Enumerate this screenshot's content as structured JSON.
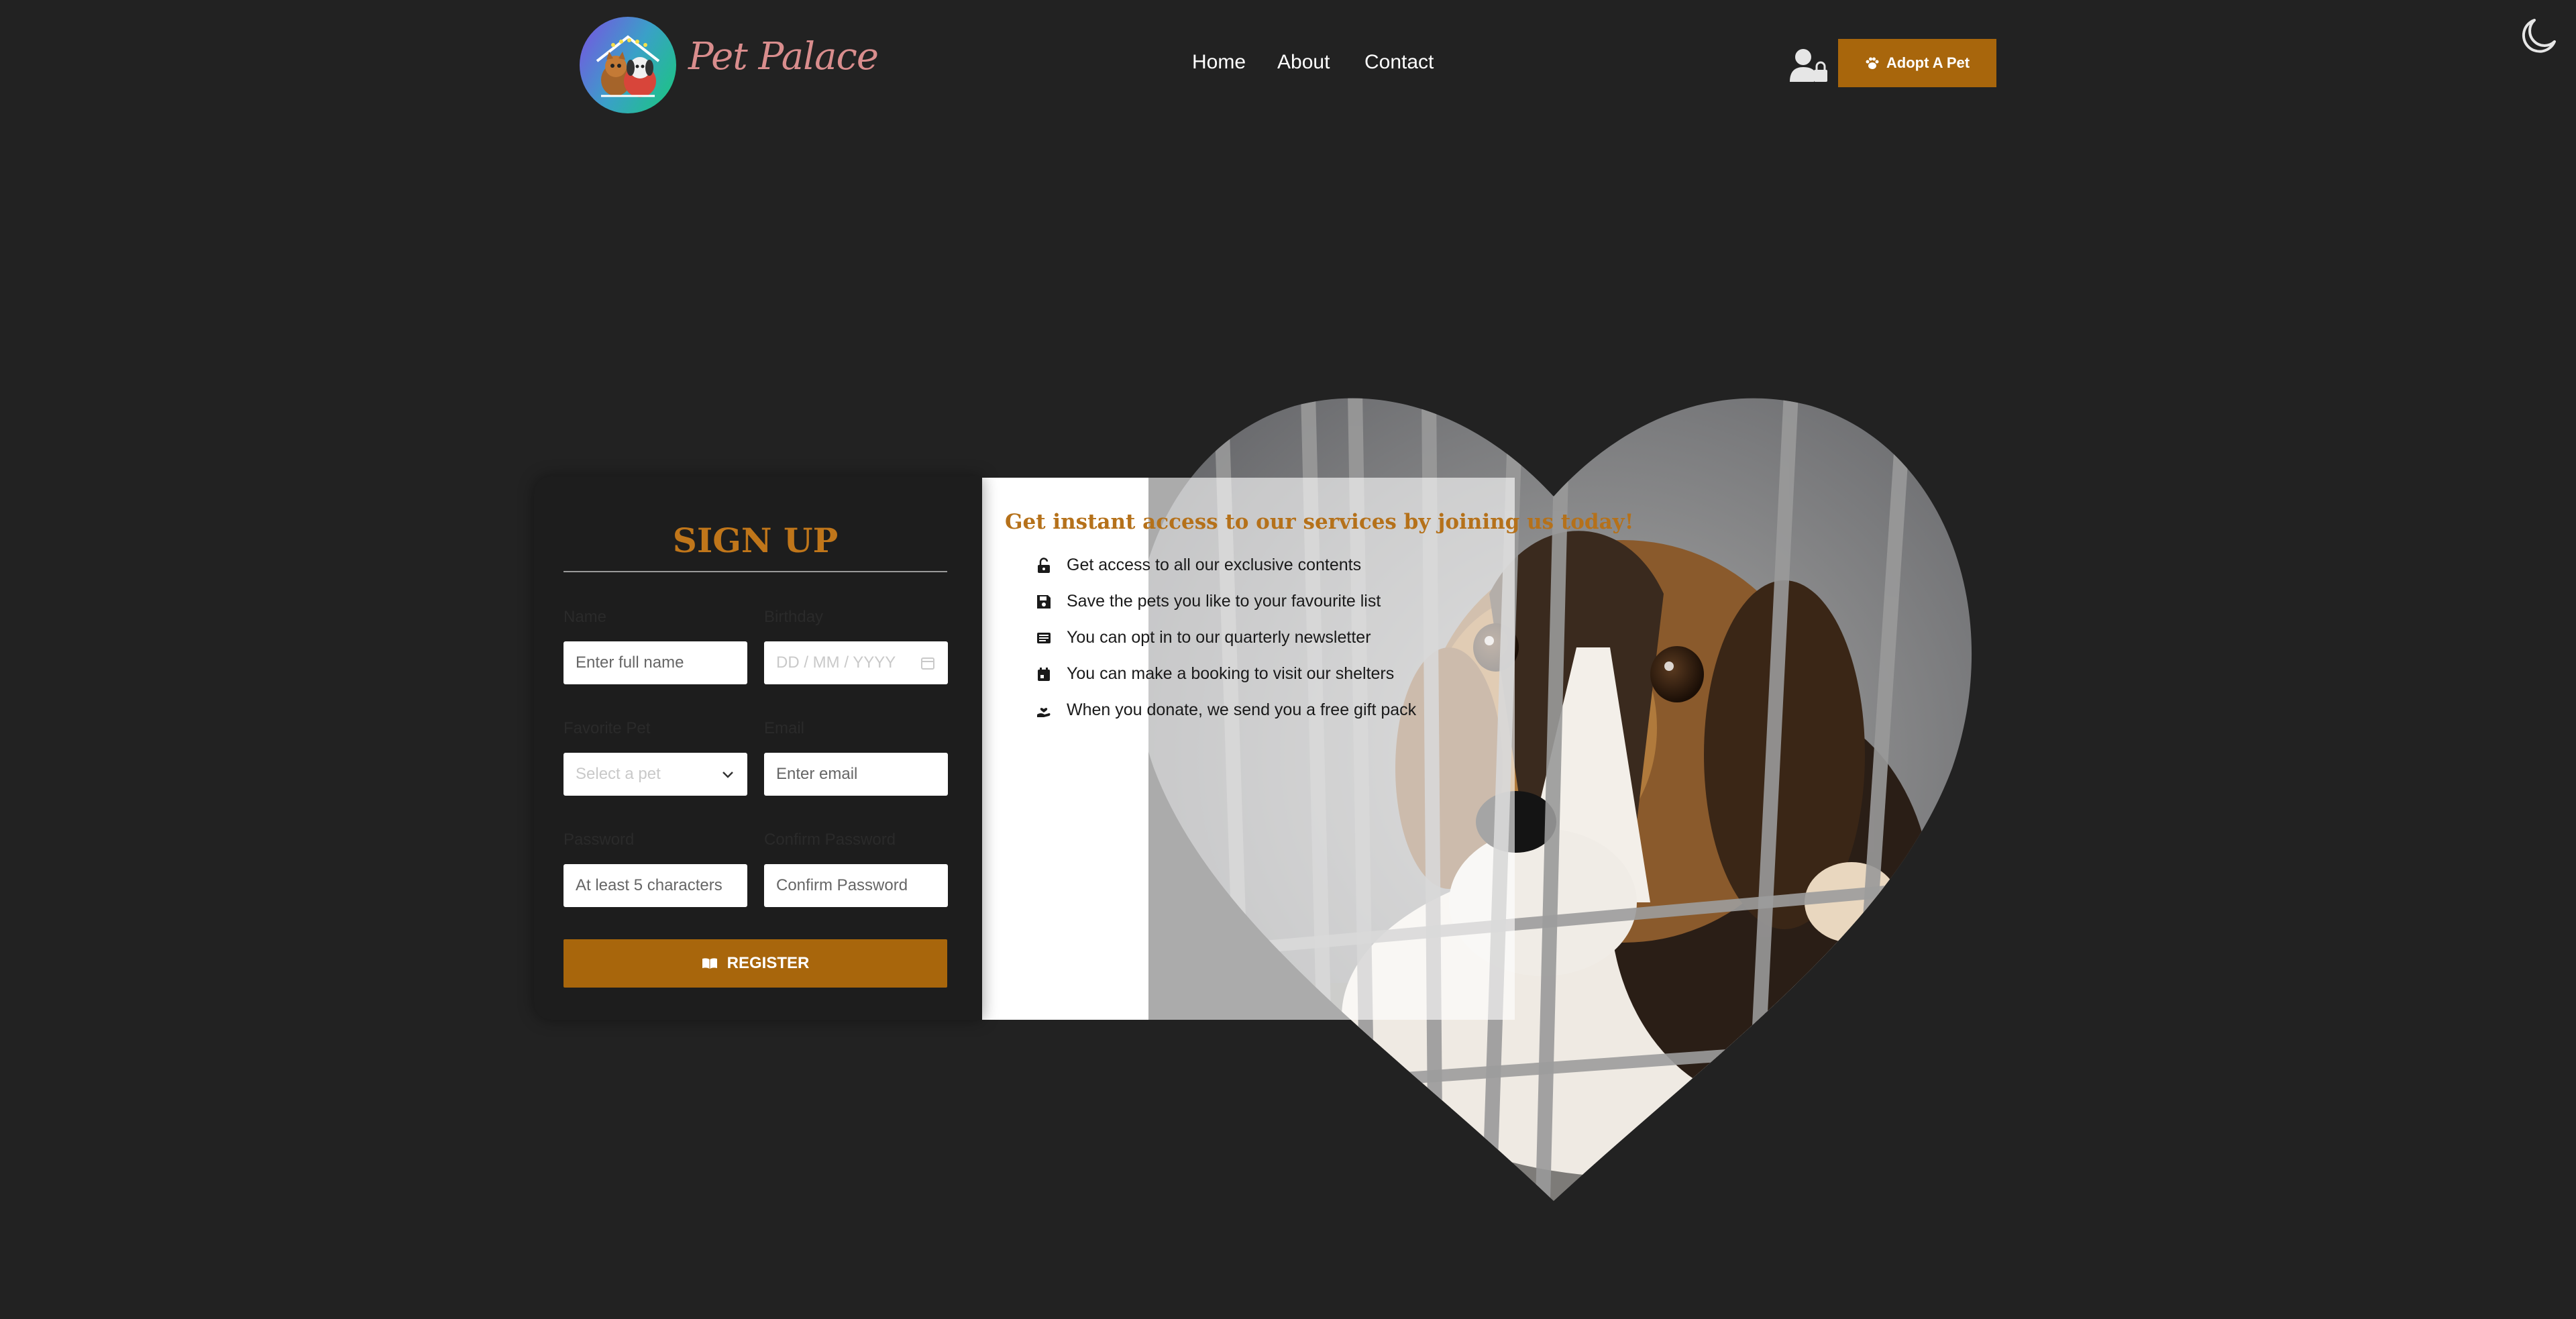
{
  "header": {
    "brand": "Pet Palace",
    "nav": [
      "Home",
      "About",
      "Contact"
    ],
    "adopt_button": "Adopt A Pet",
    "accent": "#a8660c"
  },
  "signup": {
    "title": "SIGN UP",
    "labels": {
      "name": "Name",
      "birthday": "Birthday",
      "favorite_pet": "Favorite Pet",
      "email": "Email",
      "password": "Password",
      "confirm_password": "Confirm Password"
    },
    "placeholders": {
      "name": "Enter full name",
      "birthday": "DD / MM / YYYY",
      "favorite_pet": "Select a pet",
      "email": "Enter email",
      "password": "At least 5 characters",
      "confirm_password": "Confirm Password"
    },
    "register_button": "REGISTER"
  },
  "info": {
    "title": "Get instant access to our services by joining us today!",
    "benefits": [
      {
        "icon": "unlock-icon",
        "text": "Get access to all our exclusive contents"
      },
      {
        "icon": "save-icon",
        "text": "Save the pets you like to your favourite list"
      },
      {
        "icon": "newspaper-icon",
        "text": "You can opt in to our quarterly newsletter"
      },
      {
        "icon": "calendar-icon",
        "text": "You can make a booking to visit our shelters"
      },
      {
        "icon": "hand-holding-heart-icon",
        "text": "When you donate, we send you a free gift pack"
      }
    ]
  },
  "icons": {
    "theme_toggle": "moon-icon",
    "user_login": "user-lock-icon",
    "adopt": "paw-icon",
    "register": "book-open-icon"
  }
}
